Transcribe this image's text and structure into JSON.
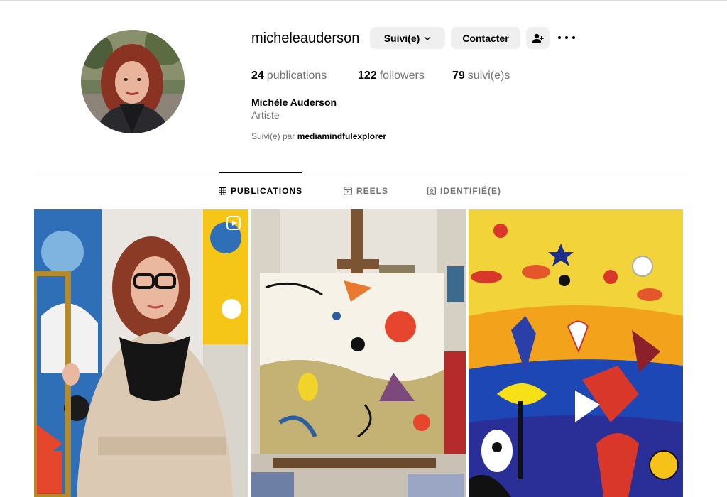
{
  "profile": {
    "username": "micheleauderson",
    "follow_button": "Suivi(e)",
    "contact_button": "Contacter",
    "stats": {
      "posts_count": "24",
      "posts_label": "publications",
      "followers_count": "122",
      "followers_label": "followers",
      "following_count": "79",
      "following_label": "suivi(e)s"
    },
    "full_name": "Michèle Auderson",
    "category": "Artiste",
    "followed_by_prefix": "Suivi(e) par",
    "followed_by_user": "mediamindfulexplorer"
  },
  "tabs": [
    {
      "label": "PUBLICATIONS",
      "icon": "grid-icon",
      "active": true
    },
    {
      "label": "REELS",
      "icon": "reels-icon",
      "active": false
    },
    {
      "label": "IDENTIFIÉ(E)",
      "icon": "tagged-icon",
      "active": false
    }
  ],
  "posts": [
    {
      "kind": "photo",
      "subject": "artist portrait with paintings",
      "badge_icon": "reels-icon"
    },
    {
      "kind": "photo",
      "subject": "painting on easel"
    },
    {
      "kind": "photo",
      "subject": "colorful abstract painting"
    }
  ]
}
